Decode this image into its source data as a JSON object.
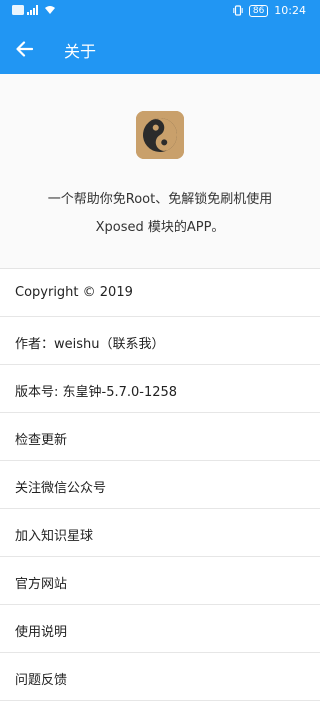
{
  "status_bar": {
    "time": "10:24",
    "battery": "86"
  },
  "app_bar": {
    "title": "关于",
    "back_icon": "arrow-back-icon"
  },
  "header": {
    "logo_icon": "yin-yang-icon",
    "description_line1": "一个帮助你免Root、免解锁免刷机使用",
    "description_line2": "Xposed 模块的APP。"
  },
  "list": {
    "items": [
      {
        "label": "Copyright © 2019"
      },
      {
        "label": "作者：weishu（联系我）"
      },
      {
        "label": "版本号: 东皇钟-5.7.0-1258"
      },
      {
        "label": "检查更新"
      },
      {
        "label": "关注微信公众号"
      },
      {
        "label": "加入知识星球"
      },
      {
        "label": "官方网站"
      },
      {
        "label": "使用说明"
      },
      {
        "label": "问题反馈"
      }
    ]
  },
  "colors": {
    "primary": "#2196f3",
    "divider": "#e6e6e6",
    "logo_bg": "#c9a06b"
  }
}
